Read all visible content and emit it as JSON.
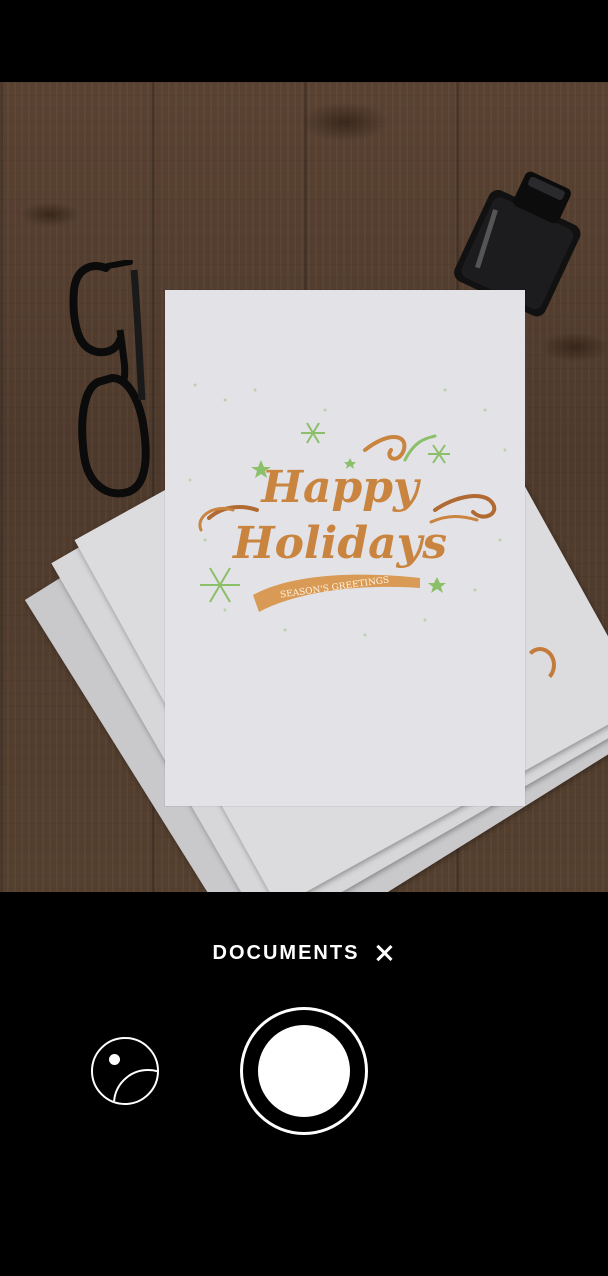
{
  "camera": {
    "mode_label": "DOCUMENTS",
    "close_icon": "close-icon",
    "gallery_icon": "gallery-icon",
    "shutter_icon": "shutter-button"
  },
  "card": {
    "line1": "Happy",
    "line2": "Holidays",
    "ribbon": "SEASON'S GREETINGS"
  },
  "colors": {
    "card_text": "#c9843f",
    "card_accent": "#8cbf6a",
    "background": "#000000"
  }
}
